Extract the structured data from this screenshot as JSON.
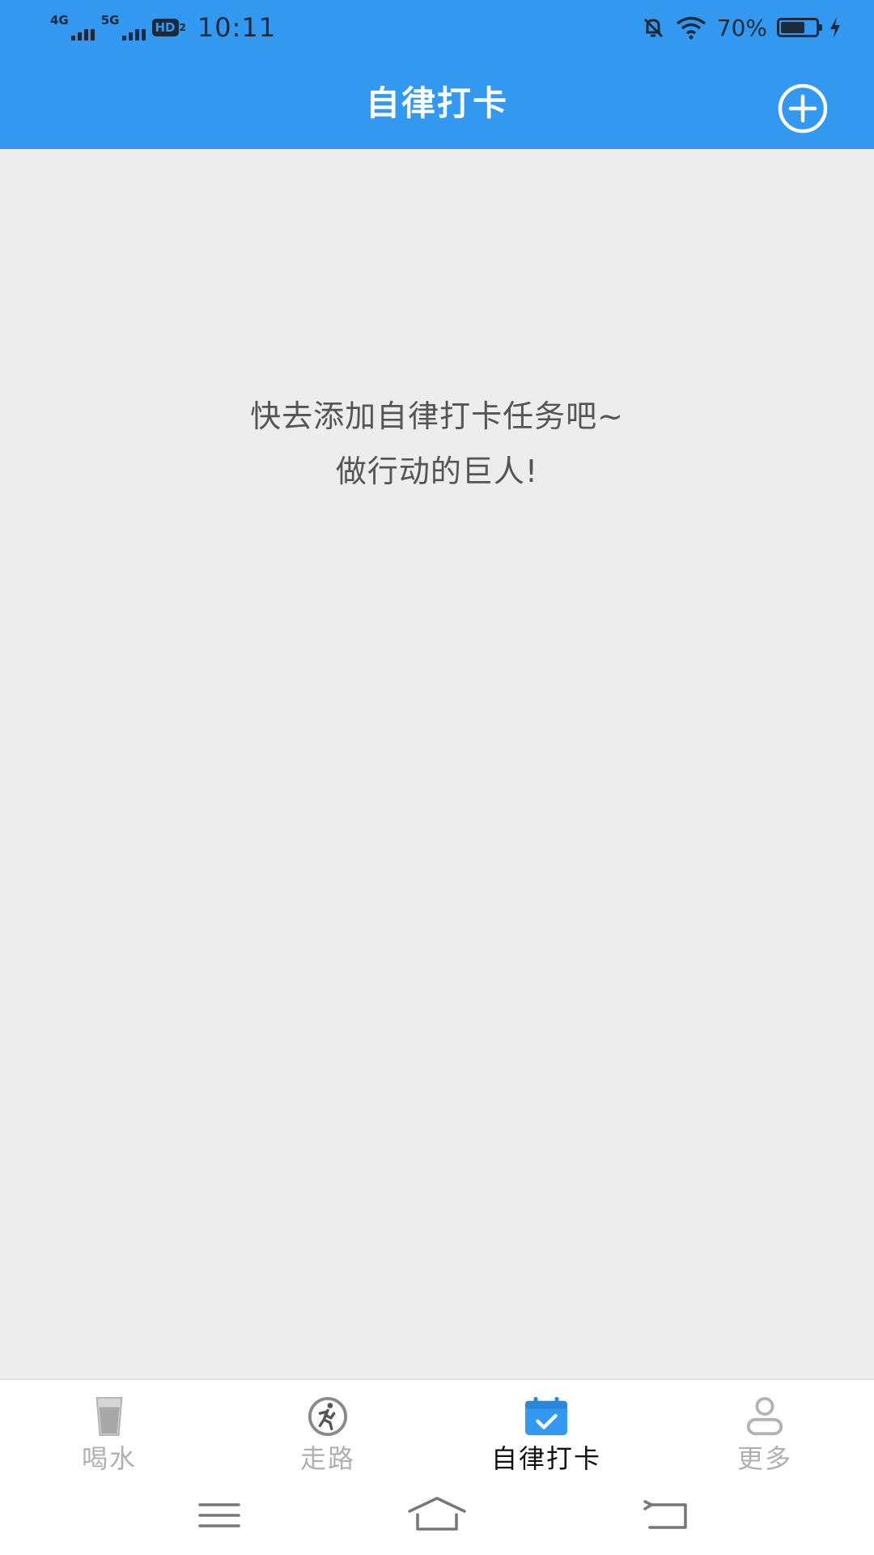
{
  "status_bar": {
    "network1": "4G",
    "network2": "5G",
    "hd_label": "HD",
    "hd_sub": "2",
    "time": "10:11",
    "battery_percent": "70%",
    "battery_level": 0.7,
    "icons": [
      "signal-icon",
      "hd-icon",
      "mute-bell-icon",
      "wifi-icon",
      "battery-icon",
      "charging-icon"
    ]
  },
  "header": {
    "title": "自律打卡",
    "add_icon": "plus-circle-icon"
  },
  "empty_state": {
    "line1": "快去添加自律打卡任务吧~",
    "line2": "做行动的巨人!"
  },
  "bottom_nav": {
    "items": [
      {
        "label": "喝水",
        "icon": "water-cup-icon",
        "active": false
      },
      {
        "label": "走路",
        "icon": "walking-icon",
        "active": false
      },
      {
        "label": "自律打卡",
        "icon": "calendar-check-icon",
        "active": true
      },
      {
        "label": "更多",
        "icon": "person-icon",
        "active": false
      }
    ]
  },
  "system_nav": {
    "icons": [
      "menu-icon",
      "home-icon",
      "back-icon"
    ]
  },
  "colors": {
    "accent": "#3399f0",
    "background": "#ededed",
    "inactive": "#b0b0b0",
    "active_label": "#111111"
  }
}
